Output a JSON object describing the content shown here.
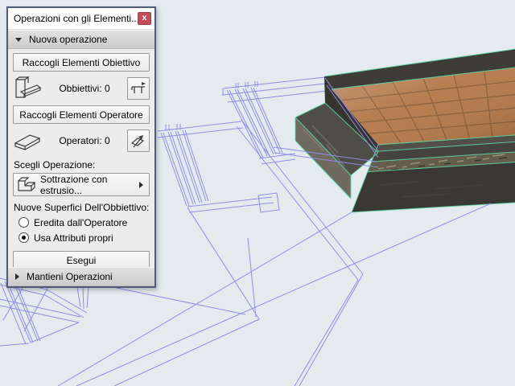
{
  "palette": {
    "title": "Operazioni con gli Elementi...",
    "close_glyph": "x",
    "section_new": "Nuova operazione",
    "section_keep": "Mantieni Operazioni",
    "collect_targets_label": "Raccogli Elementi Obiettivo",
    "collect_operators_label": "Raccogli Elementi Operatore",
    "targets_count": "Obbiettivi: 0",
    "operators_count": "Operatori: 0",
    "choose_operation_label": "Scegli Operazione:",
    "operation_value": "Sottrazione con estrusio...",
    "new_surfaces_label": "Nuove Superfici Dell'Obbiettivo:",
    "radios": [
      {
        "label": "Eredita dall'Operatore",
        "selected": false
      },
      {
        "label": "Usa Attributi propri",
        "selected": true
      }
    ],
    "execute_label": "Esegui"
  },
  "viewport": {
    "background_color": "#e4ebee",
    "wireframe_color": "#8f8de4",
    "highlight_edge_color": "#5ed4a3",
    "tile_color": "#b27747",
    "grout_color": "#7a5230",
    "concrete_dark_color": "#393834",
    "concrete_mid_color": "#524f49",
    "step_face_color": "#6e6a60"
  }
}
